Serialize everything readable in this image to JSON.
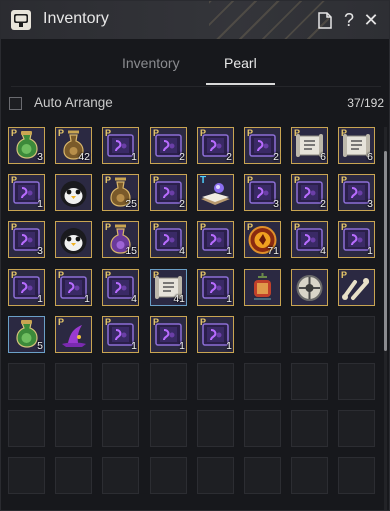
{
  "window": {
    "title": "Inventory"
  },
  "titlebar_buttons": [
    {
      "name": "document-icon",
      "glyph": "🗋"
    },
    {
      "name": "help-icon",
      "glyph": "?"
    },
    {
      "name": "close-icon",
      "glyph": "✕"
    }
  ],
  "tabs": [
    {
      "label": "Inventory",
      "active": false
    },
    {
      "label": "Pearl",
      "active": true
    }
  ],
  "auto_arrange": {
    "label": "Auto Arrange",
    "checked": false
  },
  "capacity": "37/192",
  "grid": {
    "columns": 8,
    "visible_rows": 8
  },
  "items": [
    {
      "icon": "green-potion",
      "qty": "3",
      "p": true
    },
    {
      "icon": "amber-potion",
      "qty": "42",
      "p": true
    },
    {
      "icon": "purple-book",
      "qty": "1",
      "p": true
    },
    {
      "icon": "purple-book",
      "qty": "2",
      "p": true
    },
    {
      "icon": "purple-book",
      "qty": "2",
      "p": true
    },
    {
      "icon": "purple-book",
      "qty": "2",
      "p": true
    },
    {
      "icon": "scroll",
      "qty": "6",
      "p": true
    },
    {
      "icon": "scroll",
      "qty": "6",
      "p": true
    },
    {
      "icon": "purple-book",
      "qty": "1",
      "p": true
    },
    {
      "icon": "penguin",
      "qty": "",
      "p": false
    },
    {
      "icon": "amber-potion",
      "qty": "25",
      "p": true
    },
    {
      "icon": "purple-book",
      "qty": "2",
      "p": true
    },
    {
      "icon": "open-book",
      "qty": "",
      "p": false,
      "t": true
    },
    {
      "icon": "purple-book",
      "qty": "3",
      "p": true
    },
    {
      "icon": "purple-book",
      "qty": "2",
      "p": true
    },
    {
      "icon": "purple-book",
      "qty": "3",
      "p": true
    },
    {
      "icon": "purple-book",
      "qty": "3",
      "p": true
    },
    {
      "icon": "penguin",
      "qty": "",
      "p": false
    },
    {
      "icon": "purple-potion",
      "qty": "15",
      "p": true
    },
    {
      "icon": "purple-book",
      "qty": "4",
      "p": true
    },
    {
      "icon": "purple-book",
      "qty": "1",
      "p": true
    },
    {
      "icon": "fire-orb",
      "qty": "71",
      "p": true
    },
    {
      "icon": "purple-book",
      "qty": "4",
      "p": true
    },
    {
      "icon": "purple-book",
      "qty": "1",
      "p": true
    },
    {
      "icon": "purple-book",
      "qty": "1",
      "p": true
    },
    {
      "icon": "purple-book",
      "qty": "1",
      "p": true
    },
    {
      "icon": "purple-book",
      "qty": "4",
      "p": true
    },
    {
      "icon": "scroll",
      "qty": "41",
      "p": true,
      "blue": true
    },
    {
      "icon": "purple-book",
      "qty": "1",
      "p": true
    },
    {
      "icon": "red-lantern",
      "qty": "",
      "p": false
    },
    {
      "icon": "compass",
      "qty": "",
      "p": false
    },
    {
      "icon": "bones",
      "qty": "",
      "p": true
    },
    {
      "icon": "green-potion",
      "qty": "5",
      "p": false,
      "blue": true
    },
    {
      "icon": "witch-hat",
      "qty": "",
      "p": true
    },
    {
      "icon": "purple-book",
      "qty": "1",
      "p": true
    },
    {
      "icon": "purple-book",
      "qty": "1",
      "p": true
    },
    {
      "icon": "purple-book",
      "qty": "1",
      "p": true
    }
  ]
}
